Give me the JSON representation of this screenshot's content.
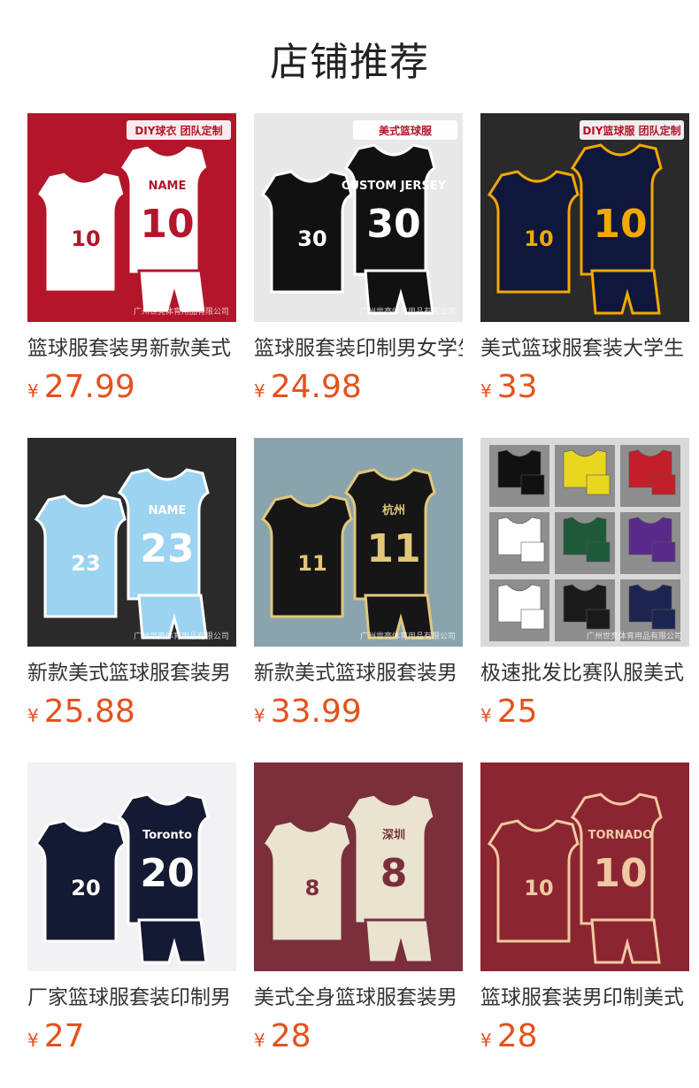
{
  "page_title": "店铺推荐",
  "currency": "¥",
  "products": [
    {
      "name": "篮球服套装男新款美式",
      "price": "27.99",
      "watermark": "广州世亮体育用品有限公司",
      "badge": "DIY球衣 团队定制",
      "jersey_text": "NAME",
      "number": "10",
      "colors": {
        "bg": "#b3162b",
        "jersey": "#ffffff",
        "trim": "#b3162b"
      }
    },
    {
      "name": "篮球服套装印制男女学生",
      "price": "24.98",
      "watermark": "广州世亮体育用品有限公司",
      "badge": "美式篮球服",
      "jersey_text": "CUSTOM JERSEY",
      "number": "30",
      "colors": {
        "bg": "#e8e8e8",
        "jersey": "#111111",
        "trim": "#ffffff"
      }
    },
    {
      "name": "美式篮球服套装大学生",
      "price": "33",
      "watermark": "",
      "badge": "DIY篮球服 团队定制",
      "jersey_text": "",
      "number": "10",
      "colors": {
        "bg": "#2a2a2a",
        "jersey": "#10173d",
        "trim": "#f2a900"
      }
    },
    {
      "name": "新款美式篮球服套装男",
      "price": "25.88",
      "watermark": "广州世亮体育用品有限公司",
      "badge": "",
      "jersey_text": "NAME",
      "number": "23",
      "colors": {
        "bg": "#2a2a2a",
        "jersey": "#9cd3f0",
        "trim": "#ffffff"
      }
    },
    {
      "name": "新款美式篮球服套装男",
      "price": "33.99",
      "watermark": "广州世亮体育用品有限公司",
      "badge": "",
      "jersey_text": "杭州",
      "number": "11",
      "colors": {
        "bg": "#8aa4ad",
        "jersey": "#161616",
        "trim": "#e2c77b"
      }
    },
    {
      "name": "极速批发比赛队服美式",
      "price": "25",
      "watermark": "广州世亮体育用品有限公司",
      "badge": "",
      "jersey_text": "",
      "number": "",
      "colors": {
        "bg": "#d9d9d9",
        "jersey": "#c21f2a",
        "trim": "#ffffff"
      }
    },
    {
      "name": "厂家篮球服套装印制男",
      "price": "27",
      "watermark": "",
      "badge": "",
      "jersey_text": "Toronto",
      "number": "20",
      "colors": {
        "bg": "#f2f2f4",
        "jersey": "#141a33",
        "trim": "#ffffff"
      }
    },
    {
      "name": "美式全身篮球服套装男",
      "price": "28",
      "watermark": "",
      "badge": "",
      "jersey_text": "深圳",
      "number": "8",
      "colors": {
        "bg": "#7a2f3a",
        "jersey": "#e9e3cf",
        "trim": "#7a2f3a"
      }
    },
    {
      "name": "篮球服套装男印制美式",
      "price": "28",
      "watermark": "",
      "badge": "",
      "jersey_text": "TORNADO",
      "number": "10",
      "colors": {
        "bg": "#8c2532",
        "jersey": "#8c2532",
        "trim": "#f0c9a2"
      }
    }
  ]
}
